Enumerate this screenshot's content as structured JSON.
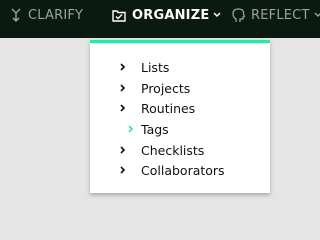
{
  "nav": {
    "clarify": {
      "label": "CLARIFY",
      "icon": "fork-arrow-icon"
    },
    "organize": {
      "label": "ORGANIZE",
      "icon": "checked-folder-icon"
    },
    "reflect": {
      "label": "REFLECT",
      "icon": "head-icon"
    }
  },
  "dropdown": {
    "accent_color": "#2ee6a0",
    "items": [
      {
        "label": "Lists"
      },
      {
        "label": "Projects"
      },
      {
        "label": "Routines"
      },
      {
        "label": "Tags",
        "active": true
      },
      {
        "label": "Checklists"
      },
      {
        "label": "Collaborators"
      }
    ]
  }
}
